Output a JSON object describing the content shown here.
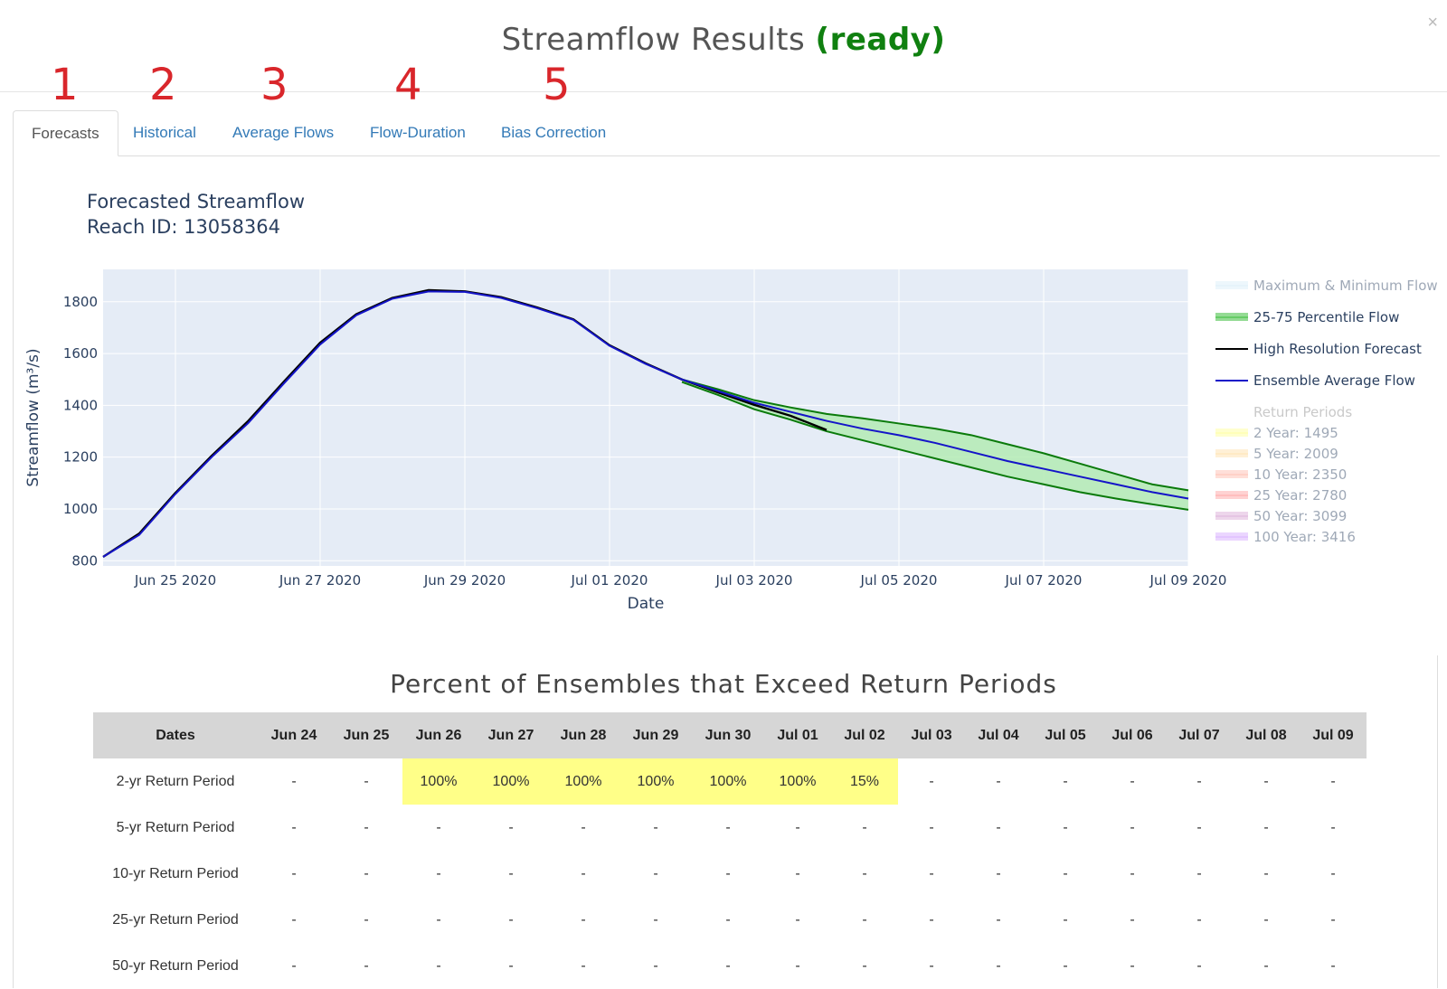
{
  "modal": {
    "title": "Streamflow Results",
    "status": "(ready)",
    "close_label": "×"
  },
  "tab_numbers": [
    "1",
    "2",
    "3",
    "4",
    "5"
  ],
  "tabs": [
    {
      "label": "Forecasts",
      "active": true
    },
    {
      "label": "Historical",
      "active": false
    },
    {
      "label": "Average Flows",
      "active": false
    },
    {
      "label": "Flow-Duration",
      "active": false
    },
    {
      "label": "Bias Correction",
      "active": false
    }
  ],
  "colors": {
    "plot_bg": "#e5ecf6",
    "ensemble": "#1414c8",
    "hires": "#000000",
    "percentile_fill": "#b4ebb4",
    "percentile_line": "#0a7a0a",
    "status": "#108010",
    "tab_number": "#d9262b",
    "highlight": "#ffff88"
  },
  "chart_data": {
    "type": "line",
    "title_line1": "Forecasted Streamflow",
    "title_line2": "Reach ID: 13058364",
    "xlabel": "Date",
    "ylabel": "Streamflow (m³/s)",
    "x_range": [
      "2020-06-24T00:00",
      "2020-07-09T00:00"
    ],
    "ylim": [
      780,
      1925
    ],
    "yticks": [
      800,
      1000,
      1200,
      1400,
      1600,
      1800
    ],
    "xticks": [
      {
        "date": "2020-06-25",
        "label": "Jun 25 2020"
      },
      {
        "date": "2020-06-27",
        "label": "Jun 27 2020"
      },
      {
        "date": "2020-06-29",
        "label": "Jun 29 2020"
      },
      {
        "date": "2020-07-01",
        "label": "Jul 01 2020"
      },
      {
        "date": "2020-07-03",
        "label": "Jul 03 2020"
      },
      {
        "date": "2020-07-05",
        "label": "Jul 05 2020"
      },
      {
        "date": "2020-07-07",
        "label": "Jul 07 2020"
      },
      {
        "date": "2020-07-09",
        "label": "Jul 09 2020"
      }
    ],
    "grid": true,
    "legend_position": "right",
    "legend": [
      {
        "label": "Maximum & Minimum Flow",
        "type": "band",
        "color": "#c8e6f5",
        "faded": true
      },
      {
        "label": "25-75 Percentile Flow",
        "type": "band",
        "color": "#66cc66",
        "faded": false
      },
      {
        "label": "High Resolution Forecast",
        "type": "line",
        "color": "#000000",
        "faded": false
      },
      {
        "label": "Ensemble Average Flow",
        "type": "line",
        "color": "#1414c8",
        "faded": false
      },
      {
        "label": "Return Periods",
        "type": "header",
        "color": "#888888",
        "faded": true
      },
      {
        "label": "2 Year: 1495",
        "type": "band",
        "color": "#ffff66",
        "faded": true
      },
      {
        "label": "5 Year: 2009",
        "type": "band",
        "color": "#ffd27f",
        "faded": true
      },
      {
        "label": "10 Year: 2350",
        "type": "band",
        "color": "#ff9b85",
        "faded": true
      },
      {
        "label": "25 Year: 2780",
        "type": "band",
        "color": "#ff7070",
        "faded": true
      },
      {
        "label": "50 Year: 3099",
        "type": "band",
        "color": "#c77fc2",
        "faded": true
      },
      {
        "label": "100 Year: 3416",
        "type": "band",
        "color": "#c07fff",
        "faded": true
      }
    ],
    "series": [
      {
        "name": "Ensemble Average Flow",
        "points": [
          [
            "2020-06-24T00:00",
            815
          ],
          [
            "2020-06-24T12:00",
            900
          ],
          [
            "2020-06-25T00:00",
            1058
          ],
          [
            "2020-06-25T12:00",
            1200
          ],
          [
            "2020-06-26T00:00",
            1330
          ],
          [
            "2020-06-26T12:00",
            1485
          ],
          [
            "2020-06-27T00:00",
            1635
          ],
          [
            "2020-06-27T12:00",
            1748
          ],
          [
            "2020-06-28T00:00",
            1812
          ],
          [
            "2020-06-28T12:00",
            1840
          ],
          [
            "2020-06-29T00:00",
            1838
          ],
          [
            "2020-06-29T12:00",
            1815
          ],
          [
            "2020-06-30T00:00",
            1775
          ],
          [
            "2020-06-30T12:00",
            1730
          ],
          [
            "2020-07-01T00:00",
            1630
          ],
          [
            "2020-07-01T12:00",
            1560
          ],
          [
            "2020-07-02T00:00",
            1500
          ],
          [
            "2020-07-02T12:00",
            1455
          ],
          [
            "2020-07-03T00:00",
            1410
          ],
          [
            "2020-07-03T12:00",
            1375
          ],
          [
            "2020-07-04T00:00",
            1340
          ],
          [
            "2020-07-04T12:00",
            1310
          ],
          [
            "2020-07-05T00:00",
            1285
          ],
          [
            "2020-07-05T12:00",
            1255
          ],
          [
            "2020-07-06T00:00",
            1220
          ],
          [
            "2020-07-06T12:00",
            1185
          ],
          [
            "2020-07-07T00:00",
            1155
          ],
          [
            "2020-07-07T12:00",
            1125
          ],
          [
            "2020-07-08T00:00",
            1095
          ],
          [
            "2020-07-08T12:00",
            1065
          ],
          [
            "2020-07-09T00:00",
            1040
          ]
        ]
      },
      {
        "name": "High Resolution Forecast",
        "points": [
          [
            "2020-06-24T00:00",
            815
          ],
          [
            "2020-06-24T12:00",
            905
          ],
          [
            "2020-06-25T00:00",
            1062
          ],
          [
            "2020-06-25T12:00",
            1205
          ],
          [
            "2020-06-26T00:00",
            1338
          ],
          [
            "2020-06-26T12:00",
            1492
          ],
          [
            "2020-06-27T00:00",
            1642
          ],
          [
            "2020-06-27T12:00",
            1752
          ],
          [
            "2020-06-28T00:00",
            1815
          ],
          [
            "2020-06-28T12:00",
            1845
          ],
          [
            "2020-06-29T00:00",
            1840
          ],
          [
            "2020-06-29T12:00",
            1818
          ],
          [
            "2020-06-30T00:00",
            1778
          ],
          [
            "2020-06-30T12:00",
            1732
          ],
          [
            "2020-07-01T00:00",
            1632
          ],
          [
            "2020-07-01T12:00",
            1562
          ],
          [
            "2020-07-02T00:00",
            1500
          ],
          [
            "2020-07-02T12:00",
            1450
          ],
          [
            "2020-07-03T00:00",
            1402
          ],
          [
            "2020-07-03T12:00",
            1360
          ],
          [
            "2020-07-04T00:00",
            1305
          ]
        ]
      },
      {
        "name": "25-75 Percentile Flow",
        "upper": [
          [
            "2020-07-02T00:00",
            1500
          ],
          [
            "2020-07-02T12:00",
            1462
          ],
          [
            "2020-07-03T00:00",
            1420
          ],
          [
            "2020-07-03T12:00",
            1392
          ],
          [
            "2020-07-04T00:00",
            1367
          ],
          [
            "2020-07-04T12:00",
            1350
          ],
          [
            "2020-07-05T00:00",
            1330
          ],
          [
            "2020-07-05T12:00",
            1310
          ],
          [
            "2020-07-06T00:00",
            1285
          ],
          [
            "2020-07-06T12:00",
            1250
          ],
          [
            "2020-07-07T00:00",
            1215
          ],
          [
            "2020-07-07T12:00",
            1175
          ],
          [
            "2020-07-08T00:00",
            1135
          ],
          [
            "2020-07-08T12:00",
            1095
          ],
          [
            "2020-07-09T00:00",
            1072
          ]
        ],
        "lower": [
          [
            "2020-07-02T00:00",
            1490
          ],
          [
            "2020-07-02T12:00",
            1440
          ],
          [
            "2020-07-03T00:00",
            1385
          ],
          [
            "2020-07-03T12:00",
            1345
          ],
          [
            "2020-07-04T00:00",
            1300
          ],
          [
            "2020-07-04T12:00",
            1265
          ],
          [
            "2020-07-05T00:00",
            1230
          ],
          [
            "2020-07-05T12:00",
            1195
          ],
          [
            "2020-07-06T00:00",
            1160
          ],
          [
            "2020-07-06T12:00",
            1125
          ],
          [
            "2020-07-07T00:00",
            1095
          ],
          [
            "2020-07-07T12:00",
            1065
          ],
          [
            "2020-07-08T00:00",
            1040
          ],
          [
            "2020-07-08T12:00",
            1018
          ],
          [
            "2020-07-09T00:00",
            997
          ]
        ]
      }
    ]
  },
  "exceedance_table": {
    "title": "Percent of Ensembles that Exceed Return Periods",
    "columns": [
      "Dates",
      "Jun 24",
      "Jun 25",
      "Jun 26",
      "Jun 27",
      "Jun 28",
      "Jun 29",
      "Jun 30",
      "Jul 01",
      "Jul 02",
      "Jul 03",
      "Jul 04",
      "Jul 05",
      "Jul 06",
      "Jul 07",
      "Jul 08",
      "Jul 09"
    ],
    "rows": [
      {
        "label": "2-yr Return Period",
        "values": [
          "-",
          "-",
          "100%",
          "100%",
          "100%",
          "100%",
          "100%",
          "100%",
          "15%",
          "-",
          "-",
          "-",
          "-",
          "-",
          "-",
          "-"
        ]
      },
      {
        "label": "5-yr Return Period",
        "values": [
          "-",
          "-",
          "-",
          "-",
          "-",
          "-",
          "-",
          "-",
          "-",
          "-",
          "-",
          "-",
          "-",
          "-",
          "-",
          "-"
        ]
      },
      {
        "label": "10-yr Return Period",
        "values": [
          "-",
          "-",
          "-",
          "-",
          "-",
          "-",
          "-",
          "-",
          "-",
          "-",
          "-",
          "-",
          "-",
          "-",
          "-",
          "-"
        ]
      },
      {
        "label": "25-yr Return Period",
        "values": [
          "-",
          "-",
          "-",
          "-",
          "-",
          "-",
          "-",
          "-",
          "-",
          "-",
          "-",
          "-",
          "-",
          "-",
          "-",
          "-"
        ]
      },
      {
        "label": "50-yr Return Period",
        "values": [
          "-",
          "-",
          "-",
          "-",
          "-",
          "-",
          "-",
          "-",
          "-",
          "-",
          "-",
          "-",
          "-",
          "-",
          "-",
          "-"
        ]
      }
    ]
  }
}
